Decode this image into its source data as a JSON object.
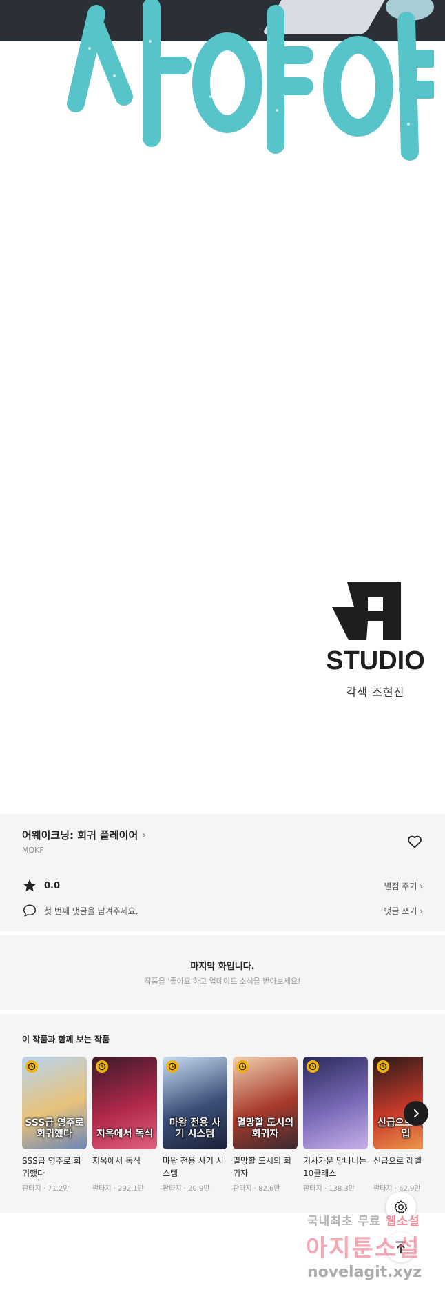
{
  "comic": {
    "title_art_text": "사야야",
    "studio_logo_text": "STUDIO",
    "studio_caption": "각색 조현진"
  },
  "series": {
    "title": "어웨이크닝: 회귀 플레이어",
    "title_chevron": "›",
    "author": "MOKF",
    "rating": "0.0",
    "rate_label": "별점 주기 ›",
    "comment_prompt": "첫 번째 댓글을 남겨주세요.",
    "write_comment_label": "댓글 쓰기 ›"
  },
  "last_episode": {
    "title": "마지막 화입니다.",
    "subtitle": "작품을 '좋아요'하고 업데이트 소식을 받아보세요!"
  },
  "recommended": {
    "section_title": "이 작품과 함께 보는 작품",
    "items": [
      {
        "thumb_text": "SSS급 영주로 회귀했다",
        "title": "SSS급 영주로 회귀했다",
        "meta": "판타지 · 71.2만",
        "colors": [
          "#b8d4ee",
          "#e8c27a",
          "#6a86b8"
        ]
      },
      {
        "thumb_text": "지옥에서 독식",
        "title": "지옥에서 독식",
        "meta": "판타지 · 292.1만",
        "colors": [
          "#3a1a2a",
          "#b0284a",
          "#e06080"
        ]
      },
      {
        "thumb_text": "마왕 전용 사기 시스템",
        "title": "마왕 전용 사기 시스템",
        "meta": "판타지 · 20.9만",
        "colors": [
          "#c8dcf2",
          "#3a4e78",
          "#1b2238"
        ]
      },
      {
        "thumb_text": "멸망할 도시의 회귀자",
        "title": "멸망할 도시의 회귀자",
        "meta": "판타지 · 82.6만",
        "colors": [
          "#f0d0b0",
          "#a83a2a",
          "#3a2a30"
        ]
      },
      {
        "thumb_text": "",
        "title": "기사가문 망나니는 10클래스",
        "meta": "판타지 · 138.3만",
        "colors": [
          "#2a2a5a",
          "#7a6ab8",
          "#c8b0e8"
        ]
      },
      {
        "thumb_text": "신급으로 레벨업",
        "title": "신급으로 레벨",
        "meta": "판타지 · 62.9만",
        "colors": [
          "#2a1a1a",
          "#c83a2a",
          "#f0a050"
        ]
      }
    ]
  },
  "watermark": {
    "line1_a": "국내최초 무료",
    "line1_b": "웹소설",
    "line2": "아지툰소설",
    "line3": "novelagit.xyz"
  },
  "icons": {
    "heart": "heart-icon",
    "star": "star-icon",
    "comment": "comment-bubble-icon",
    "clock": "clock-icon",
    "next": "chevron-right-icon",
    "settings": "gear-icon",
    "to_top": "arrow-up-icon"
  },
  "colors": {
    "title_art": "#56c4c8",
    "panel_bg": "#f5f5f5",
    "badge": "#f2b400"
  }
}
